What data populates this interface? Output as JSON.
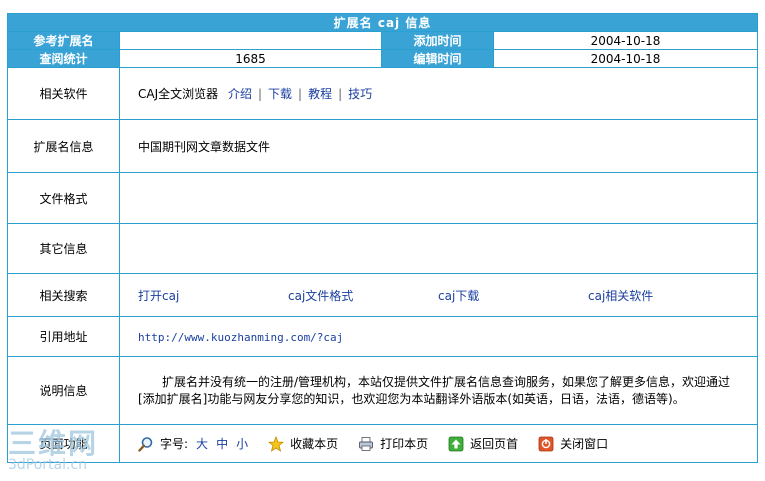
{
  "title": "扩展名 caj 信息",
  "header": {
    "ref_ext_label": "参考扩展名",
    "ref_ext_value": "",
    "add_time_label": "添加时间",
    "add_time_value": "2004-10-18",
    "views_label": "查阅统计",
    "views_value": "1685",
    "edit_time_label": "编辑时间",
    "edit_time_value": "2004-10-18"
  },
  "related_software": {
    "label": "相关软件",
    "name": "CAJ全文浏览器",
    "links": [
      "介绍",
      "下载",
      "教程",
      "技巧"
    ]
  },
  "ext_info": {
    "label": "扩展名信息",
    "value": "中国期刊网文章数据文件"
  },
  "file_format": {
    "label": "文件格式",
    "value": ""
  },
  "other_info": {
    "label": "其它信息",
    "value": ""
  },
  "related_search": {
    "label": "相关搜索",
    "links": [
      "打开caj",
      "caj文件格式",
      "caj下载",
      "caj相关软件"
    ]
  },
  "ref_url": {
    "label": "引用地址",
    "value": "http://www.kuozhanming.com/?caj"
  },
  "description": {
    "label": "说明信息",
    "text": "扩展名并没有统一的注册/管理机构，本站仅提供文件扩展名信息查询服务，如果您了解更多信息，欢迎通过[添加扩展名]功能与网友分享您的知识，也欢迎您为本站翻译外语版本(如英语，日语，法语，德语等)。"
  },
  "functions": {
    "label": "页面功能",
    "font_label": "字号:",
    "font_sizes": [
      "大",
      "中",
      "小"
    ],
    "bookmark": "收藏本页",
    "print": "打印本页",
    "back": "返回页首",
    "close": "关闭窗口"
  },
  "watermark": {
    "big": "三维网",
    "small": "3dPortal.cn"
  },
  "colors": {
    "header_bg": "#3aa3d6",
    "border": "#2aa0d0",
    "link": "#1a3fa0"
  }
}
